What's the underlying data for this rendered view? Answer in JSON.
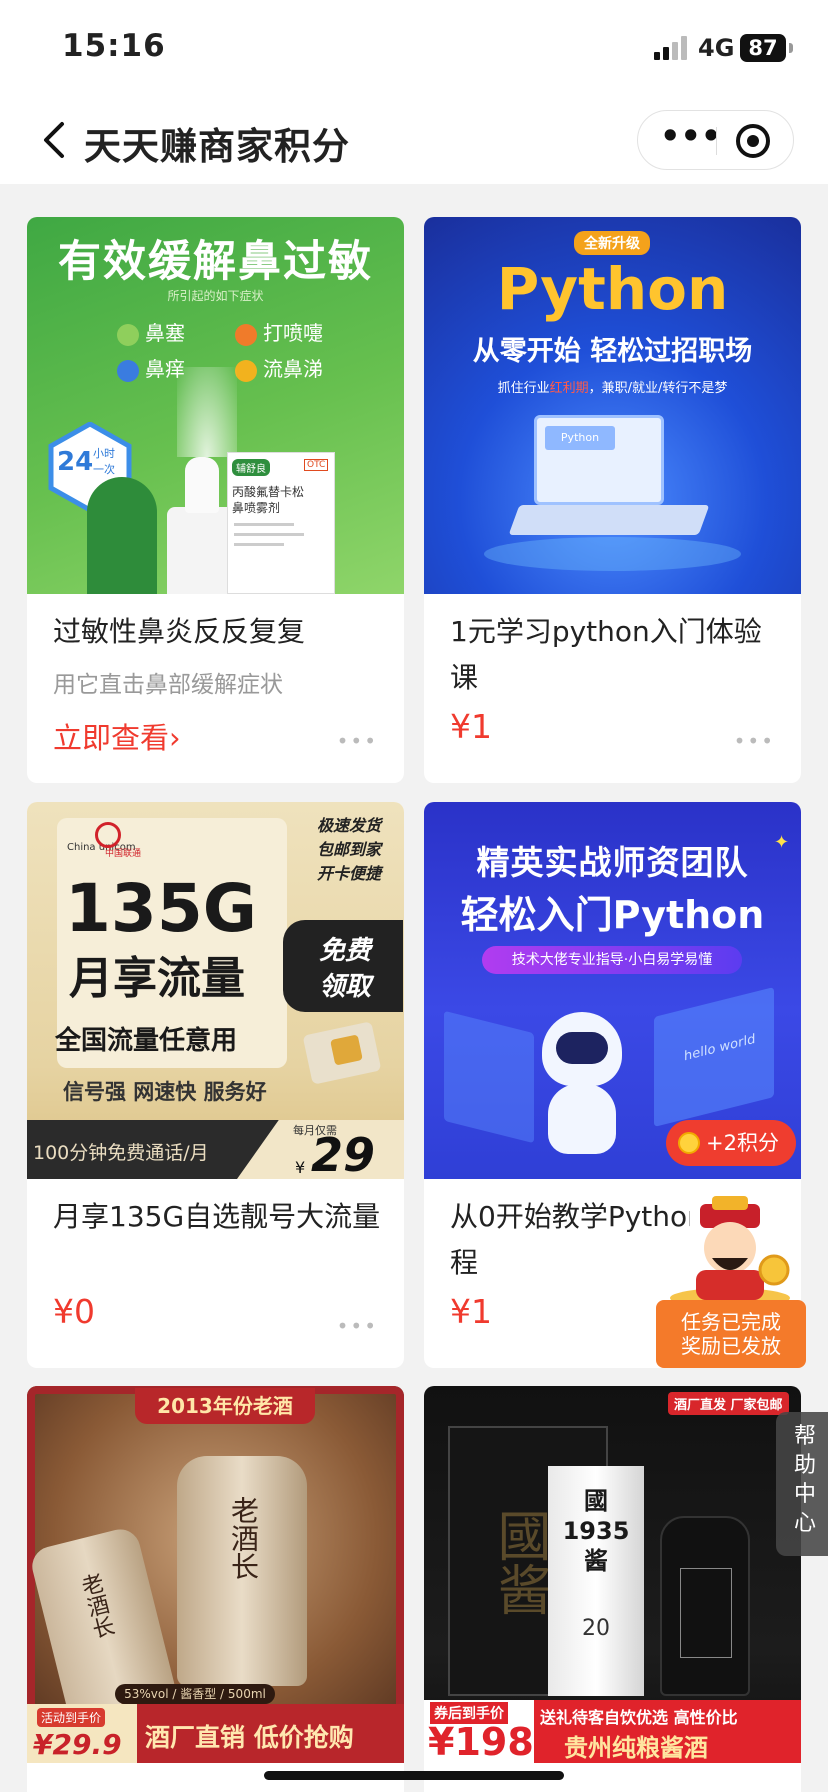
{
  "status_bar": {
    "time": "15:16",
    "network": "4G",
    "battery": "87"
  },
  "nav": {
    "title": "天天赚商家积分",
    "more_glyph": "•••"
  },
  "cards": [
    {
      "art": {
        "headline": "有效缓解鼻过敏",
        "note": "所引起的如下症状",
        "symptoms": [
          "鼻塞",
          "打喷嚏",
          "鼻痒",
          "流鼻涕"
        ],
        "badge_num": "24",
        "badge_unit": "小时",
        "badge_sub": "一次",
        "box_brand": "辅舒良",
        "box_otc": "OTC",
        "box_name": "丙酸氟替卡松",
        "box_name2": "鼻喷雾剂"
      },
      "title": "过敏性鼻炎反反复复",
      "subtitle": "用它直击鼻部缓解症状",
      "cta": "立即查看",
      "cta_arrow": "›"
    },
    {
      "art": {
        "tag": "全新升级",
        "headline": "Python",
        "sub": "从零开始 轻松过招职场",
        "desc_prefix": "抓住行业",
        "desc_highlight": "红利期",
        "desc_suffix": "，兼职/就业/转行不是梦",
        "screen_text": "Python"
      },
      "title": "1元学习python入门体验课",
      "price": "¥1"
    },
    {
      "art": {
        "brand_en": "China unicom",
        "brand_cn": "中国联通",
        "perks": [
          "极速发货",
          "包邮到家",
          "开卡便捷"
        ],
        "big": "135G",
        "big2": "月享流量",
        "line": "全国流量任意用",
        "tags": "信号强 网速快 服务好",
        "free1": "免费",
        "free2": "领取",
        "bottom": "100分钟免费通话/月",
        "monthly": "每月仅需",
        "price_sym": "¥",
        "price": "29"
      },
      "title": "月享135G自选靓号大流量",
      "price": "¥0"
    },
    {
      "art": {
        "headline1": "精英实战师资团队",
        "headline2": "轻松入门Python",
        "pill": "技术大佬专业指导·小白易学易懂",
        "screen": "hello world"
      },
      "title": "从0开始教学Python课程",
      "price": "¥1"
    },
    {
      "art": {
        "banner": "2013年份老酒",
        "bottle_label": "老酒长",
        "spec": "53%vol / 酱香型 / 500ml",
        "promo_tag": "活动到手价",
        "promo_price": "¥29.9",
        "slogan": "酒厂直销 低价抢购"
      }
    },
    {
      "art": {
        "tag": "酒厂直发 厂家包邮",
        "bag_text": "國酱",
        "box_text": "國 1935 酱",
        "box_num": "20",
        "promo_tag": "券后到手价",
        "promo_price": "¥198",
        "line1": "送礼待客自饮优选 高性价比",
        "line2": "贵州纯粮酱酒"
      }
    }
  ],
  "reward": {
    "points": "+2积分",
    "done_line1": "任务已完成",
    "done_line2": "奖励已发放"
  },
  "help": "帮助中心",
  "colors": {
    "price_red": "#f03a2e",
    "reward_orange": "#f47a2a",
    "nav_bg": "#ffffff"
  }
}
